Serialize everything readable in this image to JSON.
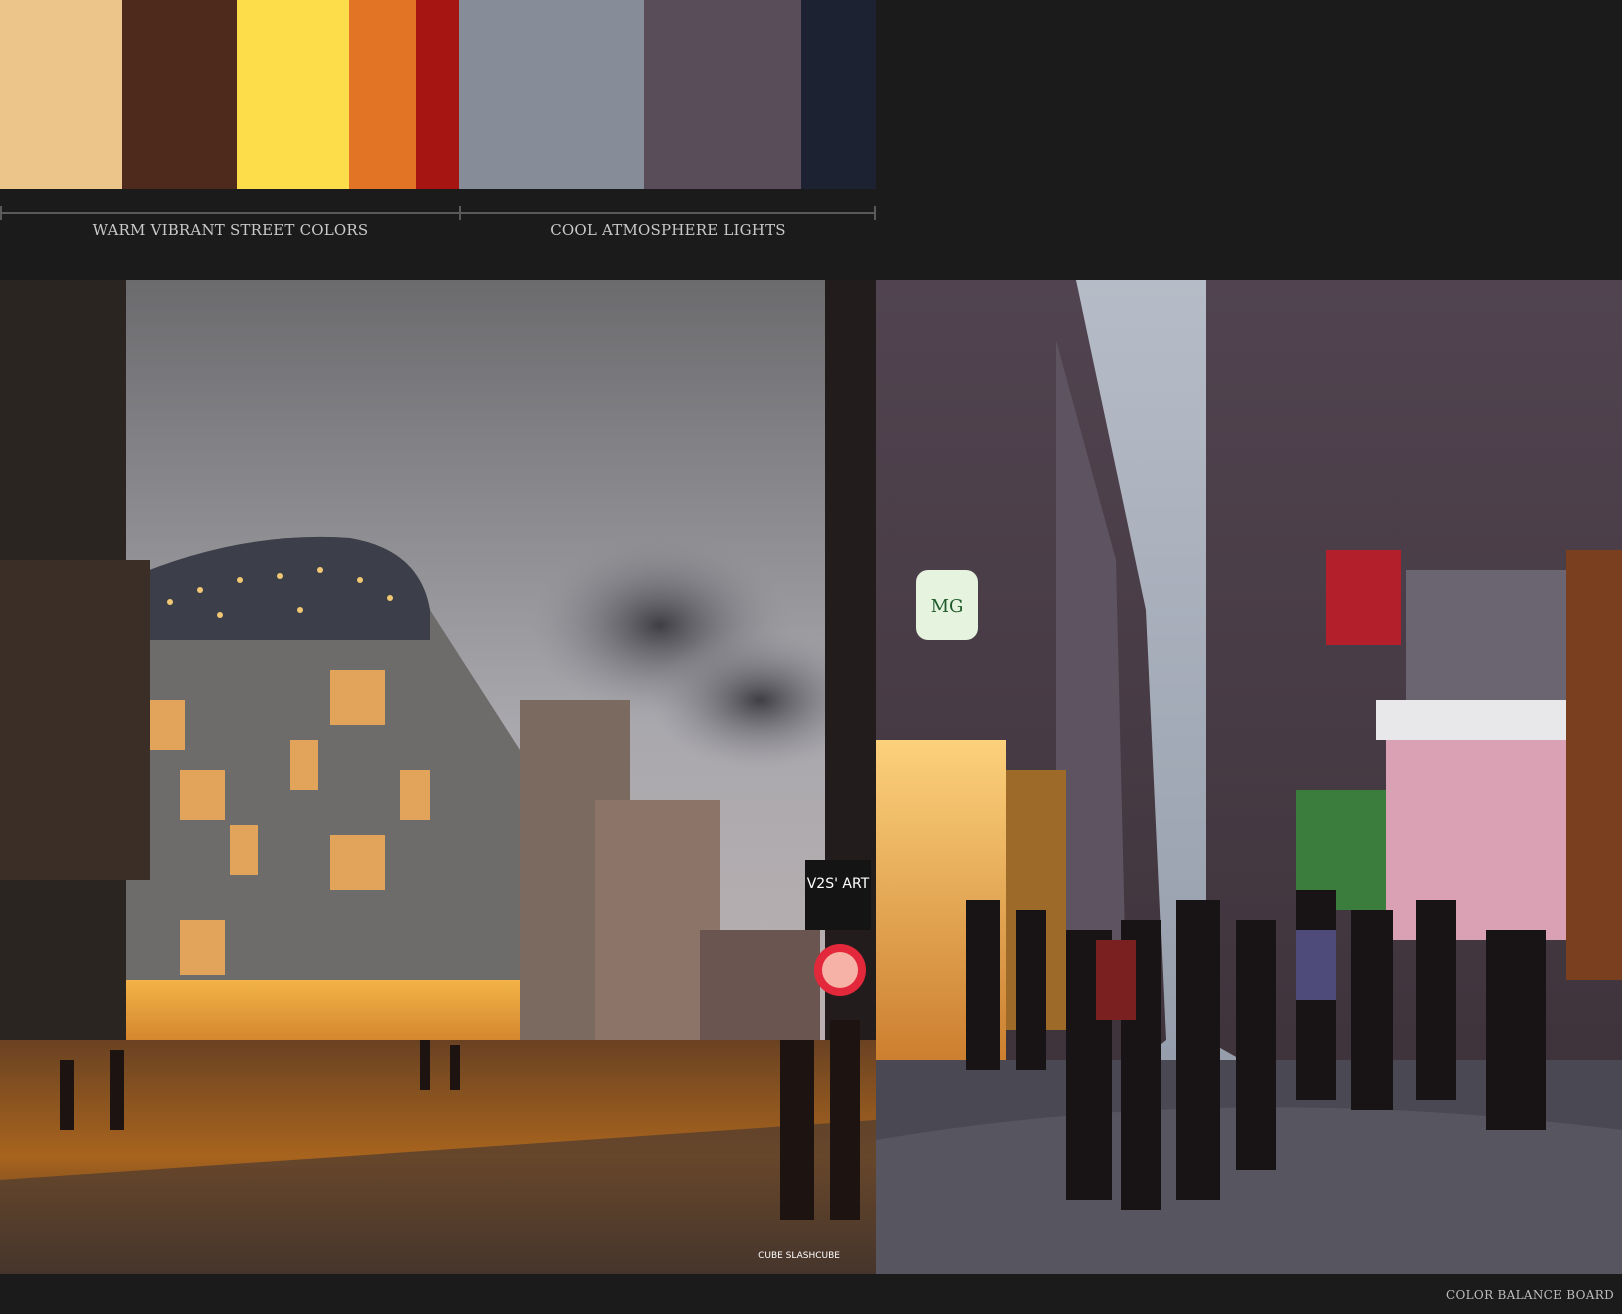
{
  "palette": {
    "swatches": [
      {
        "color": "#ebc589"
      },
      {
        "color": "#4d2a1c"
      },
      {
        "color": "#fddd4a"
      },
      {
        "color": "#e27426"
      },
      {
        "color": "#a61512"
      },
      {
        "color": "#868c98"
      },
      {
        "color": "#5a4d5a"
      },
      {
        "color": "#1c2232"
      }
    ],
    "groups": {
      "warm": "WARM VIBRANT STREET COLORS",
      "cool": "COOL ATMOSPHERE LIGHTS"
    }
  },
  "photos": {
    "left": {
      "signage": "V2S' ART",
      "watermark": "CUBE SLASHCUBE"
    },
    "right": {
      "signage": "MG"
    }
  },
  "footer": {
    "label": "COLOR BALANCE BOARD"
  }
}
